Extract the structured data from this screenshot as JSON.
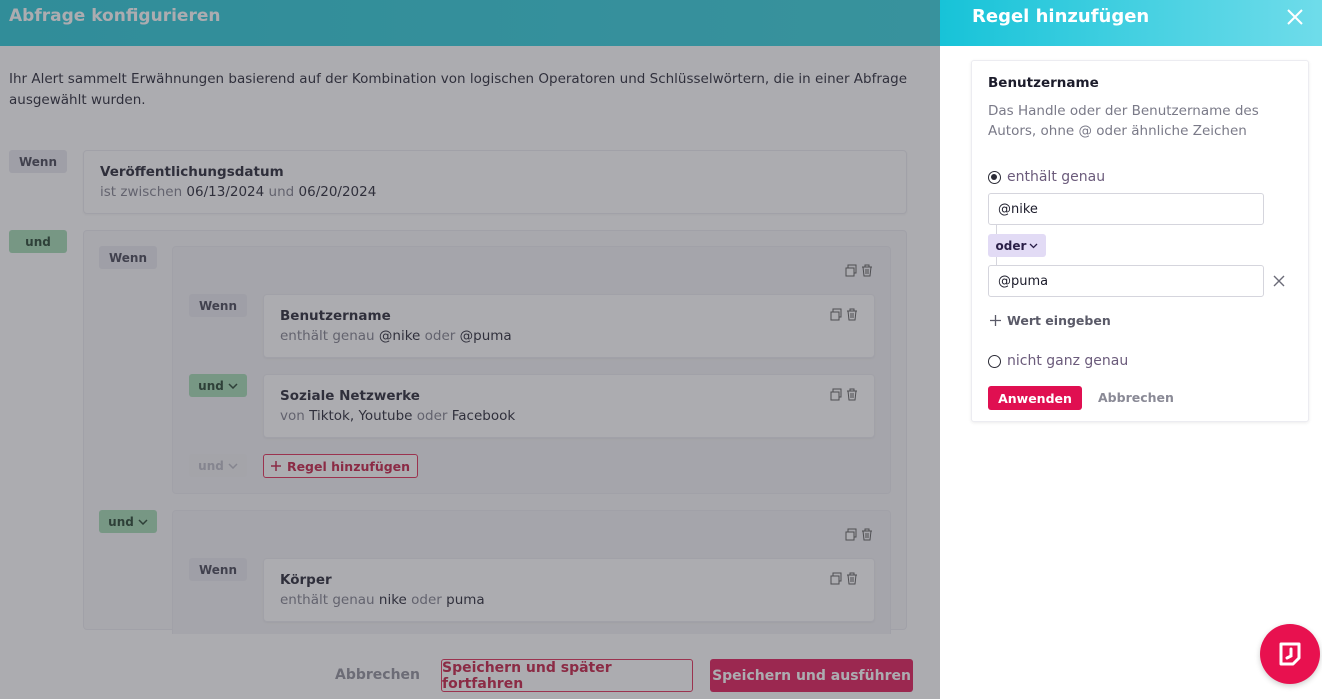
{
  "main": {
    "title": "Abfrage konfigurieren",
    "intro": "Ihr Alert sammelt Erwähnungen basierend auf der Kombination von logischen Operatoren und Schlüsselwörtern, die in einer Abfrage ausgewählt wurden.",
    "rule1": {
      "op": "Wenn",
      "title": "Veröffentlichungsdatum",
      "prefix": "ist zwischen",
      "v1": "06/13/2024",
      "join": "und",
      "v2": "06/20/2024"
    },
    "group1": {
      "op": "und",
      "inner_op": "Wenn",
      "rules": [
        {
          "op": "Wenn",
          "title": "Benutzername",
          "prefix": "enthält genau",
          "v1": "@nike",
          "join": "oder",
          "v2": "@puma"
        },
        {
          "op": "und",
          "title": "Soziale Netzwerke",
          "prefix": "von",
          "v1": "Tiktok,",
          "v1b": "Youtube",
          "join": "oder",
          "v2": "Facebook"
        }
      ],
      "next_op": "und",
      "add_rule": "Regel hinzufügen"
    },
    "group2": {
      "op": "und",
      "rules": [
        {
          "op": "Wenn",
          "title": "Körper",
          "prefix": "enthält genau",
          "v1": "nike",
          "join": "oder",
          "v2": "puma"
        }
      ]
    },
    "footer": {
      "cancel": "Abbrechen",
      "save_later": "Speichern und später fortfahren",
      "save_run": "Speichern und ausführen"
    }
  },
  "drawer": {
    "title": "Regel hinzufügen",
    "card": {
      "title": "Benutzername",
      "description": "Das Handle oder der Benutzername des Autors, ohne @ oder ähnliche Zeichen",
      "option_exact": "enthält genau",
      "option_exact_selected": true,
      "values": [
        "@nike",
        "@puma"
      ],
      "value_join": "oder",
      "add_value": "Wert eingeben",
      "option_not_exact": "nicht ganz genau",
      "apply": "Anwenden",
      "cancel": "Abbrechen"
    }
  },
  "colors": {
    "accent": "#e00f51",
    "header": "#1fc6d6",
    "and_tag": "#9fd9b0",
    "or_chip": "#e2dbf5"
  },
  "icons": [
    "copy-icon",
    "trash-icon",
    "chevron-down-icon",
    "plus-icon",
    "close-icon",
    "help-chat-icon"
  ]
}
